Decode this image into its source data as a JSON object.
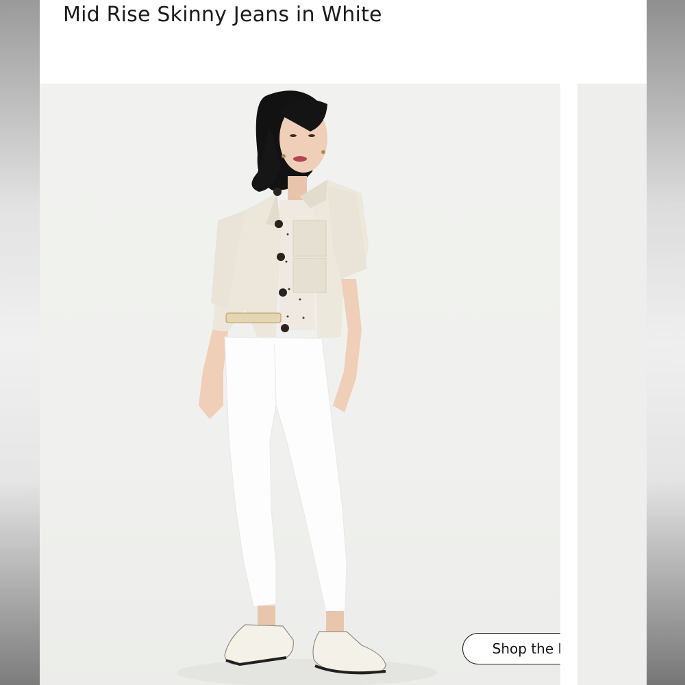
{
  "product": {
    "title": "Mid Rise Skinny Jeans in White"
  },
  "gallery": {
    "main_image_alt": "Model wearing mid rise skinny jeans in white",
    "shop_the_look_label": "Shop the Look"
  },
  "colors": {
    "background": "#ffffff",
    "text": "#1b1b1b",
    "photo_backdrop": "#f0f1ee"
  }
}
